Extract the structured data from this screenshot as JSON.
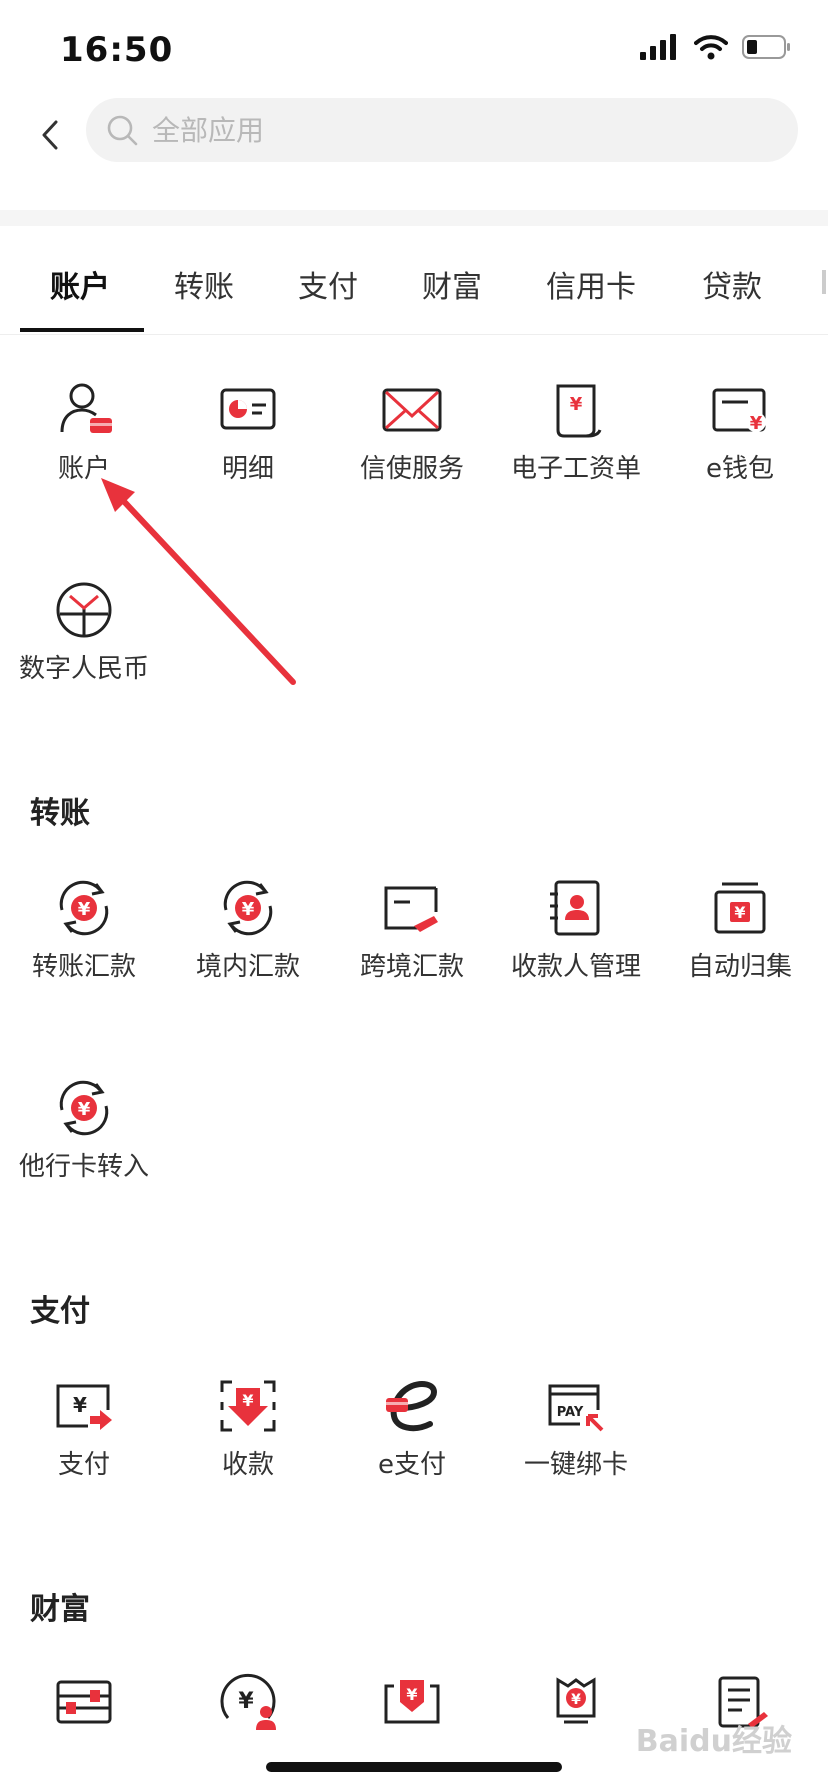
{
  "status": {
    "time": "16:50"
  },
  "search": {
    "placeholder": "全部应用"
  },
  "tabs": [
    {
      "label": "账户"
    },
    {
      "label": "转账"
    },
    {
      "label": "支付"
    },
    {
      "label": "财富"
    },
    {
      "label": "信用卡"
    },
    {
      "label": "贷款"
    }
  ],
  "sections": {
    "account": {
      "items": [
        {
          "label": "账户",
          "icon": "person-card-icon"
        },
        {
          "label": "明细",
          "icon": "statement-icon"
        },
        {
          "label": "信使服务",
          "icon": "envelope-icon"
        },
        {
          "label": "电子工资单",
          "icon": "payslip-icon"
        },
        {
          "label": "e钱包",
          "icon": "wallet-icon"
        },
        {
          "label": "数字人民币",
          "icon": "digital-rmb-icon"
        }
      ]
    },
    "transfer": {
      "title": "转账",
      "items": [
        {
          "label": "转账汇款",
          "icon": "transfer-cycle-icon"
        },
        {
          "label": "境内汇款",
          "icon": "domestic-cycle-icon"
        },
        {
          "label": "跨境汇款",
          "icon": "crossborder-icon"
        },
        {
          "label": "收款人管理",
          "icon": "payee-icon"
        },
        {
          "label": "自动归集",
          "icon": "auto-collect-icon"
        },
        {
          "label": "他行卡转入",
          "icon": "other-bank-cycle-icon"
        }
      ]
    },
    "payment": {
      "title": "支付",
      "items": [
        {
          "label": "支付",
          "icon": "pay-icon"
        },
        {
          "label": "收款",
          "icon": "receive-icon"
        },
        {
          "label": "e支付",
          "icon": "e-pay-icon"
        },
        {
          "label": "一键绑卡",
          "icon": "bind-card-icon"
        }
      ]
    },
    "wealth": {
      "title": "财富"
    }
  },
  "watermark": "Baidu经验",
  "colors": {
    "accent": "#e8323c",
    "text": "#222222",
    "search_bg": "#f2f2f2"
  }
}
